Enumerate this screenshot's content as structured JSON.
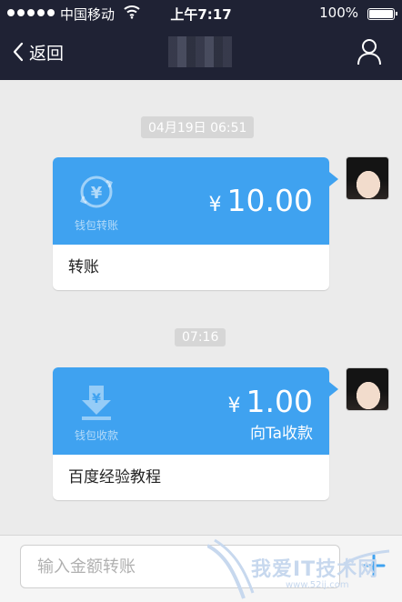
{
  "status_bar": {
    "carrier": "中国移动",
    "time": "上午7:17",
    "battery": "100%"
  },
  "nav": {
    "back_label": "返回",
    "back_icon": "chevron-left-icon",
    "profile_icon": "person-icon"
  },
  "messages": [
    {
      "timestamp": "04月19日 06:51",
      "card": {
        "type": "transfer",
        "icon": "yuan-exchange-icon",
        "icon_label": "钱包转账",
        "currency": "¥",
        "amount": "10.00",
        "caption": "转账"
      }
    },
    {
      "timestamp": "07:16",
      "card": {
        "type": "request",
        "icon": "yuan-download-icon",
        "icon_label": "钱包收款",
        "currency": "¥",
        "amount": "1.00",
        "subtext": "向Ta收款",
        "caption": "百度经验教程"
      }
    }
  ],
  "footer": {
    "input_placeholder": "输入金额转账",
    "add_icon": "plus-icon"
  },
  "watermark": {
    "text": "我爱IT技术网",
    "url": "www.52ij.com"
  },
  "colors": {
    "top_bar": "#1f2234",
    "card_accent": "#3fa2f0",
    "chat_background": "#ebebeb"
  }
}
